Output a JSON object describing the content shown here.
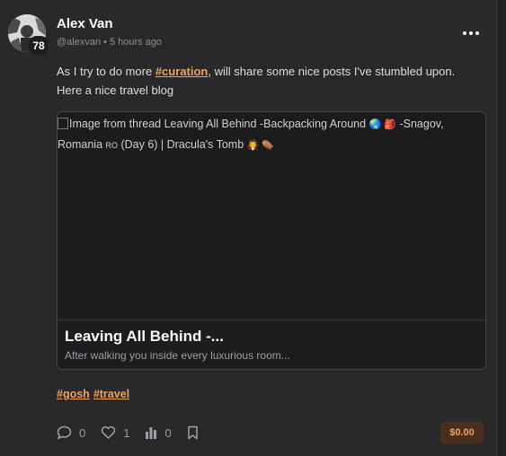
{
  "author": {
    "name": "Alex Van",
    "handle": "@alexvan",
    "time": "5 hours ago",
    "reputation": "78"
  },
  "post": {
    "text_before": "As I try to do more ",
    "inline_tag": "#curation",
    "text_after": ", will share some nice posts I've stumbled upon. Here a nice travel blog"
  },
  "link_card": {
    "image_alt_part1": "Image from thread Leaving All Behind -Backpacking Around ",
    "image_alt_emoji1": "🌏 🎒",
    "image_alt_part2": " -Snagov, Romania ",
    "image_alt_flag": "RO",
    "image_alt_part3": " (Day 6) | Dracula's Tomb ",
    "image_alt_emoji2": "🧛 ⚰️",
    "title": "Leaving All Behind -...",
    "description": "After walking you inside every luxurious room..."
  },
  "tags": [
    "#gosh",
    "#travel"
  ],
  "actions": {
    "comments": "0",
    "likes": "1",
    "views": "0"
  },
  "payout": "$0.00",
  "colors": {
    "accent": "#f0a35a",
    "background": "#29292b",
    "payout_bg": "#4a2e1f"
  },
  "icons": [
    "more-icon",
    "comment-icon",
    "heart-icon",
    "stats-icon",
    "bookmark-icon"
  ]
}
